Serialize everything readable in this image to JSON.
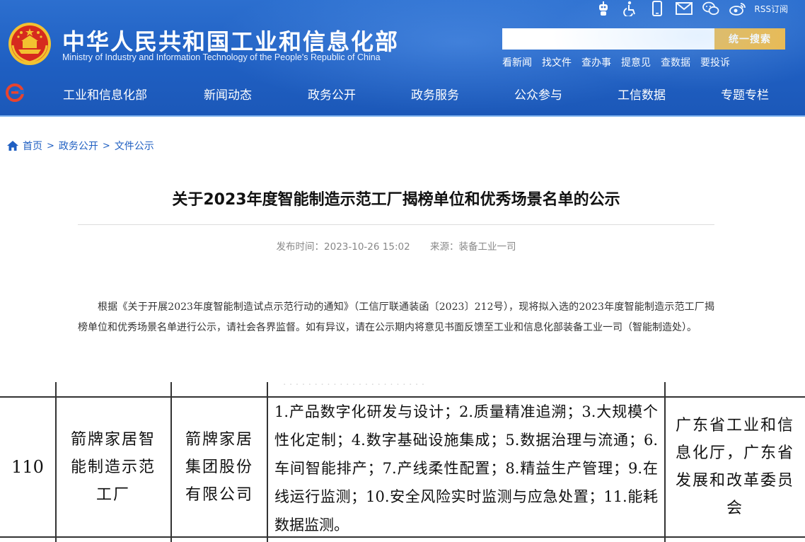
{
  "header": {
    "title": "中华人民共和国工业和信息化部",
    "subtitle": "Ministry of Industry and Information Technology of the People's Republic of China",
    "rss_label": "RSS订阅",
    "top_icons": [
      "robot-icon",
      "accessibility-icon",
      "mobile-icon",
      "mail-icon",
      "wechat-icon",
      "weibo-icon",
      "rss-icon"
    ],
    "search": {
      "placeholder": "",
      "button_label": "统一搜索"
    },
    "quick_links": [
      "看新闻",
      "找文件",
      "查办事",
      "提意见",
      "查数据",
      "要投诉"
    ],
    "nav": [
      "工业和信息化部",
      "新闻动态",
      "政务公开",
      "政务服务",
      "公众参与",
      "工信数据",
      "专题专栏"
    ]
  },
  "breadcrumb": [
    "首页",
    "政务公开",
    "文件公示"
  ],
  "article": {
    "title": "关于2023年度智能制造示范工厂揭榜单位和优秀场景名单的公示",
    "publish_time": "发布时间：2023-10-26 15:02",
    "source": "来源：装备工业一司",
    "body": "根据《关于开展2023年度智能制造试点示范行动的通知》（工信厅联通装函〔2023〕212号），现将拟入选的2023年度智能制造示范工厂揭榜单位和优秀场景名单进行公示，请社会各界监督。如有异议，请在公示期内将意见书面反馈至工业和信息化部装备工业一司（智能制造处）。"
  },
  "table_row": {
    "number": "110",
    "factory": "箭牌家居智能制造示范工厂",
    "company": "箭牌家居集团股份有限公司",
    "scenes": "1.产品数字化研发与设计；2.质量精准追溯；3.大规模个性化定制；4.数字基础设施集成；5.数据治理与流通；6.车间智能排产；7.产线柔性配置；8.精益生产管理；9.在线运行监测；10.安全风险实时监测与应急处置；11.能耗数据监测。",
    "recommender": "广东省工业和信息化厅，广东省发展和改革委员会"
  },
  "colors": {
    "header_blue": "#1f5fc2",
    "search_button": "#f0b945",
    "link_blue": "#1f5fc2"
  }
}
